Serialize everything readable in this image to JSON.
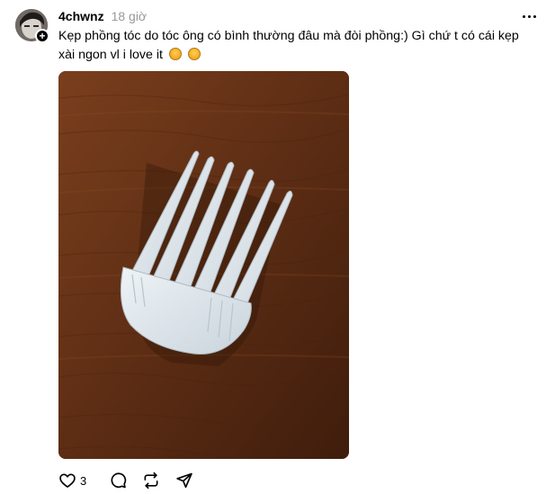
{
  "post": {
    "username": "4chwnz",
    "timestamp": "18 giờ",
    "caption": "Kẹp phồng tóc do tóc ông có bình thường đâu mà đòi phồng:) Gì chứ t có cái kẹp xài ngon vl i love it",
    "caption_emojis": [
      "face-with-hearts-emoji",
      "smiling-face-with-hearts-emoji"
    ],
    "image_description_icon": "photo-of-white-plastic-hair-comb-clip-on-wooden-table",
    "likes": "3",
    "follow_badge": "+"
  },
  "icons": {
    "more": "more-horizontal-icon",
    "like": "heart-icon",
    "reply": "comment-bubble-icon",
    "repost": "repost-arrows-icon",
    "share": "send-icon"
  },
  "colors": {
    "text": "#000000",
    "muted": "#999999",
    "wood": "#6b3418",
    "comb": "#dde5ea"
  }
}
